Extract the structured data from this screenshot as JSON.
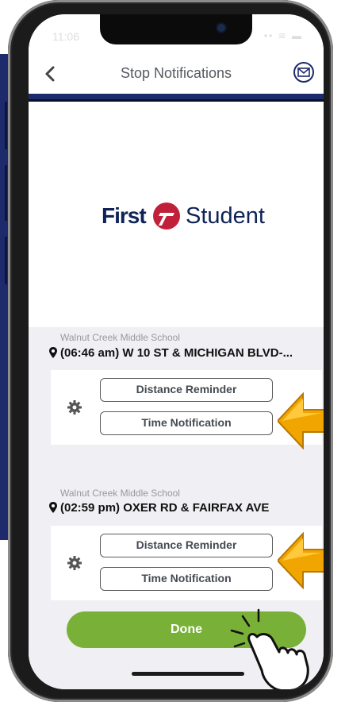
{
  "status": {
    "time": "11:06",
    "right": "•• ≋ ▬"
  },
  "header": {
    "title": "Stop Notifications",
    "back_icon": "chevron-left-icon",
    "mail_icon": "mail-icon"
  },
  "logo": {
    "first": "First",
    "student": "Student",
    "brand_color": "#0f2356",
    "mark_color": "#c1203b"
  },
  "stops": [
    {
      "school": "Walnut Creek Middle School",
      "label": "(06:46 am) W 10 ST & MICHIGAN BLVD-...",
      "distance_label": "Distance Reminder",
      "time_label": "Time Notification"
    },
    {
      "school": "Walnut Creek Middle School",
      "label": "(02:59 pm) OXER RD & FAIRFAX AVE",
      "distance_label": "Distance Reminder",
      "time_label": "Time Notification"
    }
  ],
  "done_label": "Done",
  "colors": {
    "nav": "#1d2a6b",
    "done": "#79b038",
    "arrow": "#f0a500"
  }
}
